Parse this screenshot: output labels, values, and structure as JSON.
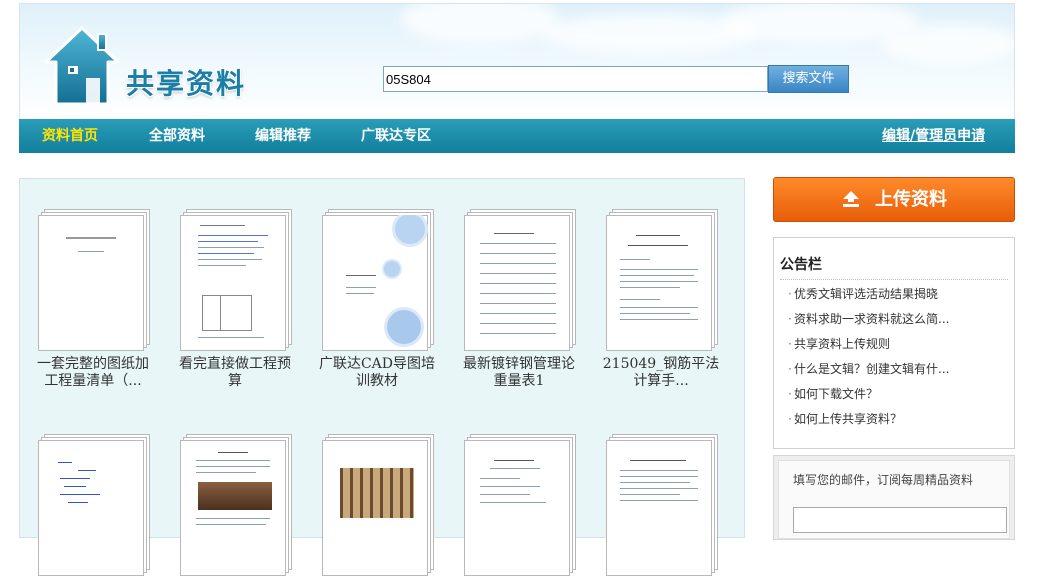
{
  "header": {
    "logo_text": "共享资料",
    "search_value": "05S804",
    "search_button": "搜索文件"
  },
  "nav": {
    "items": [
      {
        "label": "资料首页",
        "active": true
      },
      {
        "label": "全部资料"
      },
      {
        "label": "编辑推荐"
      },
      {
        "label": "广联达专区"
      }
    ],
    "apply_link": "编辑/管理员申请"
  },
  "docs_row1": [
    {
      "title_line1": "一套完整的图纸加",
      "title_line2": "工程量清单（..."
    },
    {
      "title_line1": "看完直接做工程预",
      "title_line2": "算"
    },
    {
      "title_line1": "广联达CAD导图培",
      "title_line2": "训教材"
    },
    {
      "title_line1": "最新镀锌钢管理论",
      "title_line2": "重量表1"
    },
    {
      "title_line1": "215049_钢筋平法",
      "title_line2": "计算手..."
    }
  ],
  "sidebar": {
    "upload_label": "上传资料",
    "notice_title": "公告栏",
    "notices": [
      "优秀文辑评选活动结果揭晓",
      "资料求助一求资料就这么简...",
      "共享资料上传规则",
      "什么是文辑？创建文辑有什...",
      "如何下载文件？",
      "如何上传共享资料？"
    ],
    "subscribe_text": "填写您的邮件，订阅每周精品资料"
  },
  "colors": {
    "nav_bg": "#1a8fab",
    "nav_active": "#ffe400",
    "upload_orange": "#ef6d14",
    "logo_blue": "#1a7fa8"
  }
}
